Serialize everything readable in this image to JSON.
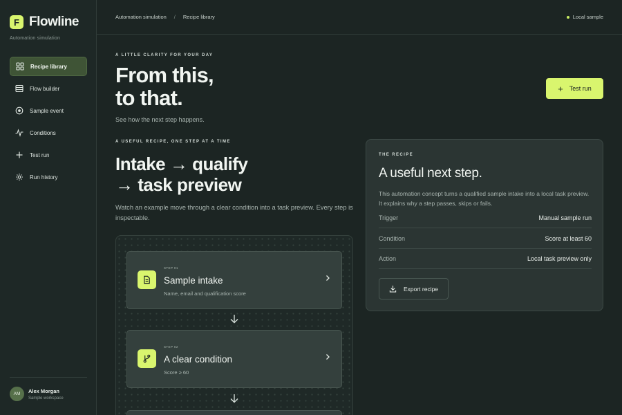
{
  "brand": {
    "logo_letter": "F",
    "name": "Flowline",
    "subtitle": "Automation simulation"
  },
  "sidebar": {
    "items": [
      {
        "label": "Recipe library",
        "icon": "grid-icon",
        "active": true
      },
      {
        "label": "Flow builder",
        "icon": "list-icon",
        "active": false
      },
      {
        "label": "Sample event",
        "icon": "target-icon",
        "active": false
      },
      {
        "label": "Conditions",
        "icon": "pulse-icon",
        "active": false
      },
      {
        "label": "Test run",
        "icon": "plus-icon",
        "active": false
      },
      {
        "label": "Run history",
        "icon": "gear-icon",
        "active": false
      }
    ]
  },
  "user": {
    "initials": "AM",
    "name": "Alex Morgan",
    "workspace": "Sample workspace"
  },
  "topbar": {
    "breadcrumb": [
      "Automation simulation",
      "Recipe library"
    ],
    "separator": "/",
    "status": "Local sample"
  },
  "hero": {
    "eyebrow": "A LITTLE CLARITY FOR YOUR DAY",
    "title_line1": "From this,",
    "title_line2": "to that.",
    "subtitle": "See how the next step happens.",
    "button_label": "Test run"
  },
  "recipe": {
    "eyebrow": "A USEFUL RECIPE, ONE STEP AT A TIME",
    "title_line1": "Intake → qualify",
    "title_line2": "→ task preview",
    "description": "Watch an example move through a clear condition into a task preview. Every step is inspectable."
  },
  "steps": [
    {
      "num": "STEP 01",
      "title": "Sample intake",
      "subtitle": "Name, email and qualification score",
      "icon": "document-icon"
    },
    {
      "num": "STEP 02",
      "title": "A clear condition",
      "subtitle": "Score ≥ 60",
      "icon": "branch-icon"
    }
  ],
  "card": {
    "eyebrow": "THE RECIPE",
    "title": "A useful next step.",
    "description": "This automation concept turns a qualified sample intake into a local task preview. It explains why a step passes, skips or fails.",
    "rows": [
      {
        "key": "Trigger",
        "value": "Manual sample run"
      },
      {
        "key": "Condition",
        "value": "Score at least 60"
      },
      {
        "key": "Action",
        "value": "Local task preview only"
      }
    ],
    "export_label": "Export recipe"
  },
  "colors": {
    "accent": "#d9f56e",
    "background": "#1c2523",
    "active_nav": "#3f5436"
  }
}
